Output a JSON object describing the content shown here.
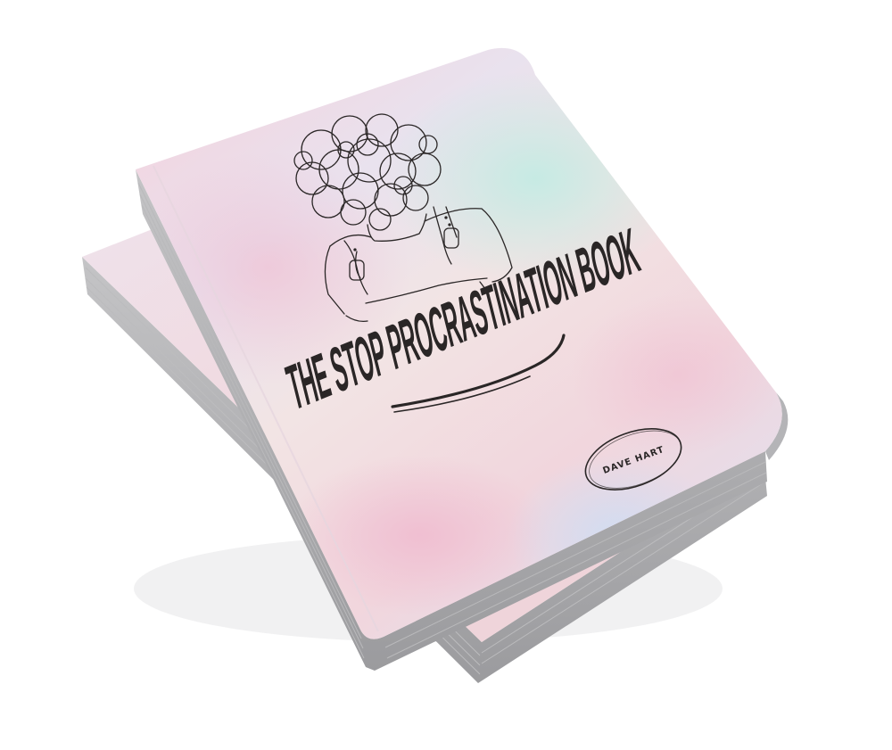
{
  "book": {
    "title": "THE STOP PROCRASTINATION BOOK",
    "author": "DAVE HART"
  },
  "colors": {
    "background": "#ffffff",
    "ink": "#2a2626",
    "page_edge": "#a9a9ab",
    "cover_pink": "#f2c9d6",
    "cover_mint": "#cde9e3",
    "cover_lavender": "#dcd6ee",
    "cover_peach": "#f3d9cf"
  }
}
